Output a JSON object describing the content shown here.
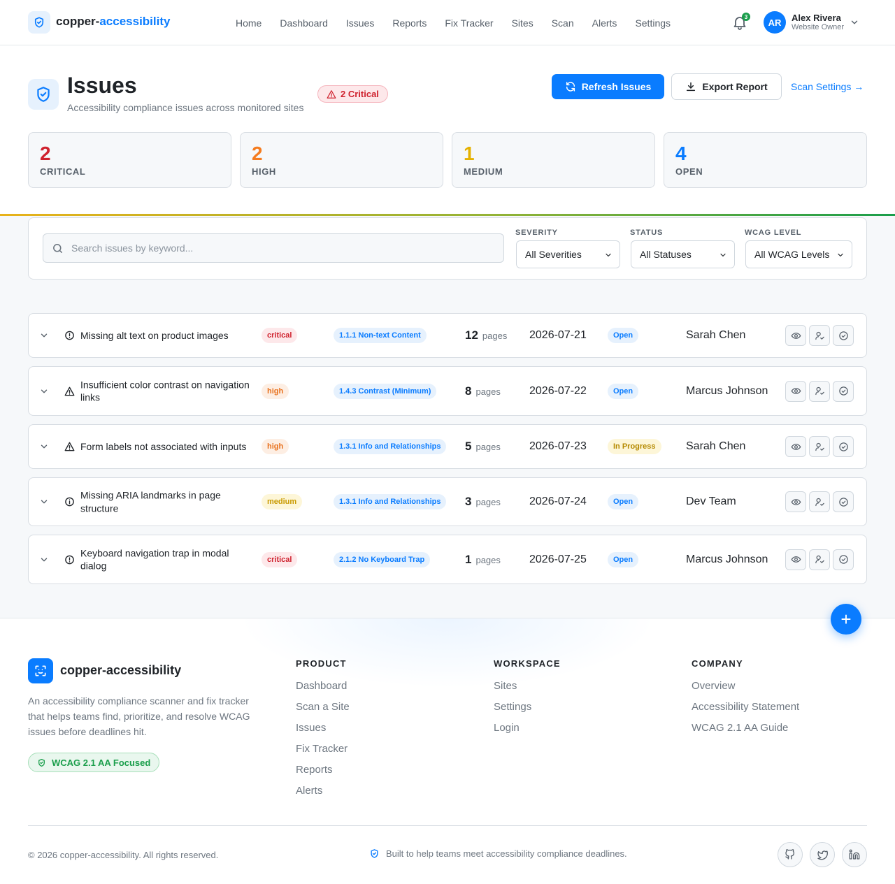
{
  "header": {
    "brand_primary": "copper-",
    "brand_accent": "accessibility",
    "nav": [
      "Home",
      "Dashboard",
      "Issues",
      "Reports",
      "Fix Tracker",
      "Sites",
      "Scan",
      "Alerts",
      "Settings"
    ],
    "notification_count": "3",
    "user": {
      "initials": "AR",
      "name": "Alex Rivera",
      "role": "Website Owner"
    }
  },
  "page": {
    "title": "Issues",
    "subtitle": "Accessibility compliance issues across monitored sites",
    "critical_badge": "2 Critical",
    "refresh_label": "Refresh Issues",
    "export_label": "Export Report",
    "settings_link": "Scan Settings →"
  },
  "stats": [
    {
      "value": "2",
      "label": "CRITICAL",
      "color": "#cf222e"
    },
    {
      "value": "2",
      "label": "HIGH",
      "color": "#f57c1f"
    },
    {
      "value": "1",
      "label": "MEDIUM",
      "color": "#e5b100"
    },
    {
      "value": "4",
      "label": "OPEN",
      "color": "#0a7cff"
    }
  ],
  "filters": {
    "search_placeholder": "Search issues by keyword...",
    "severity_label": "SEVERITY",
    "severity_value": "All Severities",
    "status_label": "STATUS",
    "status_value": "All Statuses",
    "wcag_label": "WCAG LEVEL",
    "wcag_value": "All WCAG Levels"
  },
  "issues": [
    {
      "title": "Missing alt text on product images",
      "severity": "critical",
      "wcag": "1.1.1 Non-text Content",
      "pages": "12",
      "pages_unit": "pages",
      "date": "2026-07-21",
      "status": "Open",
      "assignee": "Sarah Chen"
    },
    {
      "title": "Insufficient color contrast on navigation links",
      "severity": "high",
      "wcag": "1.4.3 Contrast (Minimum)",
      "pages": "8",
      "pages_unit": "pages",
      "date": "2026-07-22",
      "status": "Open",
      "assignee": "Marcus Johnson"
    },
    {
      "title": "Form labels not associated with inputs",
      "severity": "high",
      "wcag": "1.3.1 Info and Relationships",
      "pages": "5",
      "pages_unit": "pages",
      "date": "2026-07-23",
      "status": "In Progress",
      "assignee": "Sarah Chen"
    },
    {
      "title": "Missing ARIA landmarks in page structure",
      "severity": "medium",
      "wcag": "1.3.1 Info and Relationships",
      "pages": "3",
      "pages_unit": "pages",
      "date": "2026-07-24",
      "status": "Open",
      "assignee": "Dev Team"
    },
    {
      "title": "Keyboard navigation trap in modal dialog",
      "severity": "critical",
      "wcag": "2.1.2 No Keyboard Trap",
      "pages": "1",
      "pages_unit": "pages",
      "date": "2026-07-25",
      "status": "Open",
      "assignee": "Marcus Johnson"
    }
  ],
  "footer": {
    "brand": "copper-accessibility",
    "description": "An accessibility compliance scanner and fix tracker that helps teams find, prioritize, and resolve WCAG issues before deadlines hit.",
    "badge": "WCAG 2.1 AA Focused",
    "product_heading": "PRODUCT",
    "product_links": [
      "Dashboard",
      "Scan a Site",
      "Issues",
      "Fix Tracker",
      "Reports",
      "Alerts"
    ],
    "workspace_heading": "WORKSPACE",
    "workspace_links": [
      "Sites",
      "Settings",
      "Login"
    ],
    "company_heading": "COMPANY",
    "company_links": [
      "Overview",
      "Accessibility Statement",
      "WCAG 2.1 AA Guide"
    ],
    "copyright": "© 2026 copper-accessibility. All rights reserved.",
    "tagline": "Built to help teams meet accessibility compliance deadlines."
  },
  "fab_label": "+"
}
